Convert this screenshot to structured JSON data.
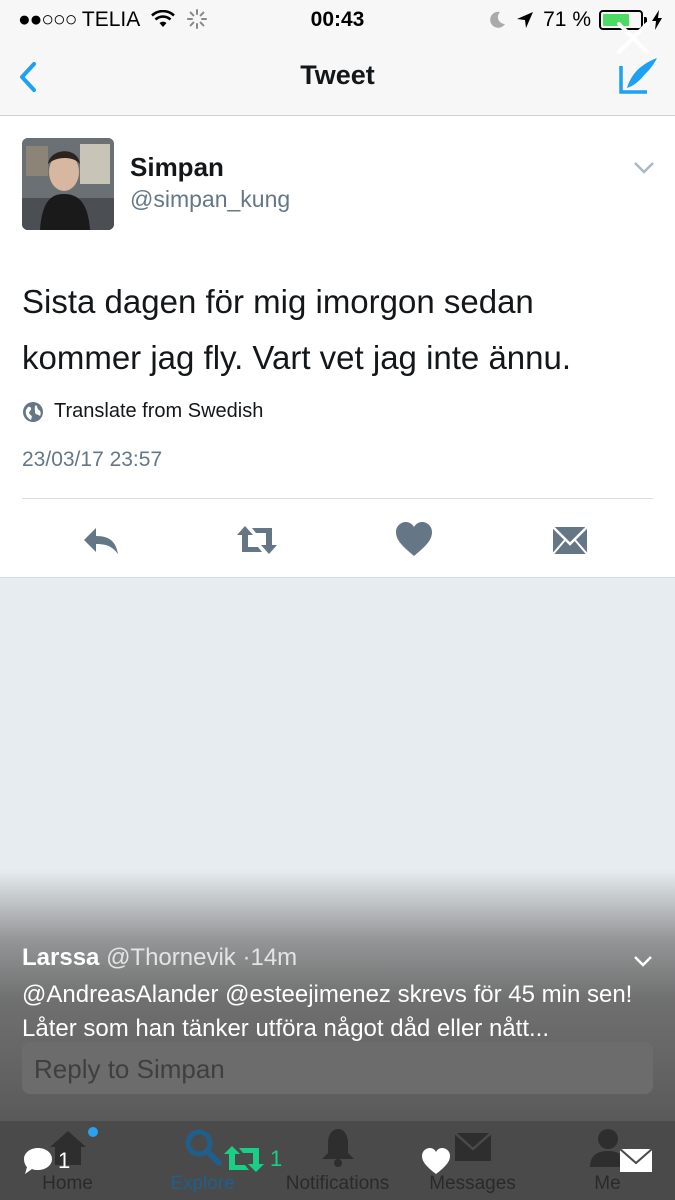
{
  "status_bar": {
    "signal": "●●○○○",
    "carrier": "TELIA",
    "time": "00:43",
    "battery": "71 %",
    "battery_level": 0.71
  },
  "nav": {
    "title": "Tweet"
  },
  "tweet": {
    "author_name": "Simpan",
    "author_handle": "@simpan_kung",
    "text": "Sista dagen för mig imorgon sedan kommer jag fly. Vart vet jag inte ännu.",
    "translate_label": "Translate from Swedish",
    "timestamp": "23/03/17 23:57"
  },
  "reply": {
    "placeholder": "Reply to Simpan"
  },
  "notification": {
    "author_name": "Larssa",
    "author_handle": "@Thornevik",
    "separator": "·",
    "age": "14m",
    "text": "@AndreasAlander @esteejimenez skrevs för 45 min sen! Låter som han tänker utföra något dåd eller nått...",
    "reply_count": "1",
    "retweet_count": "1"
  },
  "tabs": [
    {
      "label": "Home",
      "icon": "home-icon"
    },
    {
      "label": "Explore",
      "icon": "search-icon"
    },
    {
      "label": "Notifications",
      "icon": "bell-icon"
    },
    {
      "label": "Messages",
      "icon": "envelope-icon"
    },
    {
      "label": "Me",
      "icon": "person-icon"
    }
  ],
  "colors": {
    "accent": "#1da1f2",
    "retweet_green": "#19cf86",
    "action_gray": "#657786"
  }
}
